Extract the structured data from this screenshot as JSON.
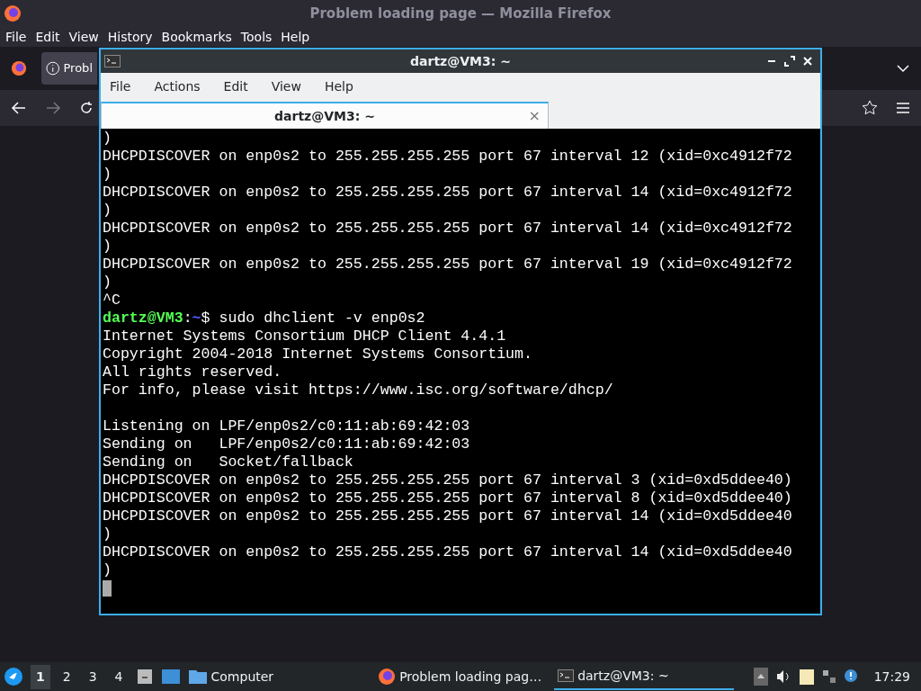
{
  "firefox": {
    "title": "Problem loading page — Mozilla Firefox",
    "menu": [
      "File",
      "Edit",
      "View",
      "History",
      "Bookmarks",
      "Tools",
      "Help"
    ],
    "tab": {
      "label": "Probl"
    }
  },
  "terminal": {
    "title": "dartz@VM3: ~",
    "menu": [
      "File",
      "Actions",
      "Edit",
      "View",
      "Help"
    ],
    "tab": {
      "label": "dartz@VM3: ~",
      "close": "×"
    },
    "lines": [
      {
        "kind": "output",
        "text": ")"
      },
      {
        "kind": "output",
        "text": "DHCPDISCOVER on enp0s2 to 255.255.255.255 port 67 interval 12 (xid=0xc4912f72"
      },
      {
        "kind": "output",
        "text": ")"
      },
      {
        "kind": "output",
        "text": "DHCPDISCOVER on enp0s2 to 255.255.255.255 port 67 interval 14 (xid=0xc4912f72"
      },
      {
        "kind": "output",
        "text": ")"
      },
      {
        "kind": "output",
        "text": "DHCPDISCOVER on enp0s2 to 255.255.255.255 port 67 interval 14 (xid=0xc4912f72"
      },
      {
        "kind": "output",
        "text": ")"
      },
      {
        "kind": "output",
        "text": "DHCPDISCOVER on enp0s2 to 255.255.255.255 port 67 interval 19 (xid=0xc4912f72"
      },
      {
        "kind": "output",
        "text": ")"
      },
      {
        "kind": "output",
        "text": "^C"
      },
      {
        "kind": "prompt",
        "user": "dartz@VM3",
        "separator": ":",
        "path": "~",
        "symbol": "$",
        "command": " sudo dhclient -v enp0s2"
      },
      {
        "kind": "output",
        "text": "Internet Systems Consortium DHCP Client 4.4.1"
      },
      {
        "kind": "output",
        "text": "Copyright 2004-2018 Internet Systems Consortium."
      },
      {
        "kind": "output",
        "text": "All rights reserved."
      },
      {
        "kind": "output",
        "text": "For info, please visit https://www.isc.org/software/dhcp/"
      },
      {
        "kind": "blank"
      },
      {
        "kind": "output",
        "text": "Listening on LPF/enp0s2/c0:11:ab:69:42:03"
      },
      {
        "kind": "output",
        "text": "Sending on   LPF/enp0s2/c0:11:ab:69:42:03"
      },
      {
        "kind": "output",
        "text": "Sending on   Socket/fallback"
      },
      {
        "kind": "output",
        "text": "DHCPDISCOVER on enp0s2 to 255.255.255.255 port 67 interval 3 (xid=0xd5ddee40)"
      },
      {
        "kind": "output",
        "text": "DHCPDISCOVER on enp0s2 to 255.255.255.255 port 67 interval 8 (xid=0xd5ddee40)"
      },
      {
        "kind": "output",
        "text": "DHCPDISCOVER on enp0s2 to 255.255.255.255 port 67 interval 14 (xid=0xd5ddee40"
      },
      {
        "kind": "output",
        "text": ")"
      },
      {
        "kind": "output",
        "text": "DHCPDISCOVER on enp0s2 to 255.255.255.255 port 67 interval 14 (xid=0xd5ddee40"
      },
      {
        "kind": "output",
        "text": ")"
      },
      {
        "kind": "cursor"
      }
    ]
  },
  "taskbar": {
    "workspaces": [
      {
        "label": "1",
        "selected": true
      },
      {
        "label": "2",
        "selected": false
      },
      {
        "label": "3",
        "selected": false
      },
      {
        "label": "4",
        "selected": false
      }
    ],
    "launchers": [
      {
        "kind": "folder",
        "label": "Computer"
      }
    ],
    "tasks": [
      {
        "kind": "firefox",
        "label": "Problem loading pag…",
        "selected": false
      },
      {
        "kind": "terminal",
        "label": "dartz@VM3: ~",
        "selected": true
      }
    ],
    "clock": "17:29"
  }
}
